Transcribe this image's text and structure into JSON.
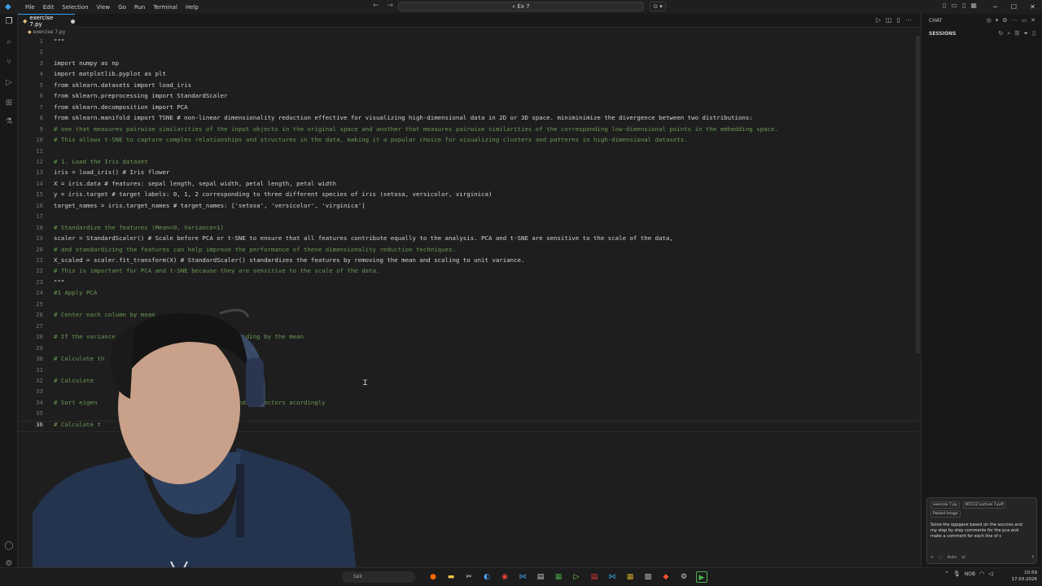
{
  "titlebar": {
    "menu": [
      "File",
      "Edit",
      "Selection",
      "View",
      "Go",
      "Run",
      "Terminal",
      "Help"
    ],
    "search_text": "Ex 7",
    "copilot_label": "⊙ ▾"
  },
  "tabs": [
    {
      "label": "exercise 7.py",
      "modified": true
    }
  ],
  "breadcrumb": "exercise 7.py",
  "editor": {
    "lines": [
      {
        "n": "1",
        "text": "\"\"\"",
        "style": "code"
      },
      {
        "n": "2",
        "text": "",
        "style": "code"
      },
      {
        "n": "3",
        "text": "import numpy as np",
        "style": "code"
      },
      {
        "n": "4",
        "text": "import matplotlib.pyplot as plt",
        "style": "code"
      },
      {
        "n": "5",
        "text": "from sklearn.datasets import load_iris",
        "style": "code"
      },
      {
        "n": "6",
        "text": "from sklearn.preprocessing import StandardScaler",
        "style": "code"
      },
      {
        "n": "7",
        "text": "from sklearn.decomposition import PCA",
        "style": "code"
      },
      {
        "n": "8",
        "text": "from sklearn.manifold import TSNE # non-linear dimensionality reduction effective for visualizing high-dimensional data in 2D or 3D space. miniminimize the divergence between two distributions:",
        "style": "code"
      },
      {
        "n": "9",
        "text": "# one that measures pairwise similarities of the input objects in the original space and another that measures pairwise similarities of the corresponding low-dimensional points in the embedding space.",
        "style": "code"
      },
      {
        "n": "10",
        "text": "# This allows t-SNE to capture complex relationships and structures in the data, making it a popular choice for visualizing clusters and patterns in high-dimensional datasets.",
        "style": "code"
      },
      {
        "n": "11",
        "text": "",
        "style": "code"
      },
      {
        "n": "12",
        "text": "# 1. Load the Iris dataset",
        "style": "code"
      },
      {
        "n": "13",
        "text": "iris = load_iris() # Iris flower",
        "style": "code"
      },
      {
        "n": "14",
        "text": "X = iris.data # features: sepal length, sepal width, petal length, petal width",
        "style": "code"
      },
      {
        "n": "15",
        "text": "y = iris.target # target labels: 0, 1, 2 corresponding to three different species of iris (setosa, versicolor, virginica)",
        "style": "code"
      },
      {
        "n": "16",
        "text": "target_names = iris.target_names # target_names: ['setosa', 'versicolor', 'virginica']",
        "style": "code"
      },
      {
        "n": "17",
        "text": "",
        "style": "code"
      },
      {
        "n": "18",
        "text": "# Standardize the features (Mean=0, Variance=1)",
        "style": "code"
      },
      {
        "n": "19",
        "text": "scaler = StandardScaler() # Scale before PCA or t-SNE to ensure that all features contribute equally to the analysis. PCA and t-SNE are sensitive to the scale of the data,",
        "style": "code"
      },
      {
        "n": "20",
        "text": "# and standardizing the features can help improve the performance of these dimensionality reduction techniques.",
        "style": "code"
      },
      {
        "n": "21",
        "text": "X_scaled = scaler.fit_transform(X) # StandardScaler() standardizes the features by removing the mean and scaling to unit variance.",
        "style": "code"
      },
      {
        "n": "22",
        "text": "# This is important for PCA and t-SNE because they are sensitive to the scale of the data.",
        "style": "code"
      },
      {
        "n": "23",
        "text": "\"\"\"",
        "style": "code"
      },
      {
        "n": "24",
        "text": "#1 Apply PCA",
        "style": "comment"
      },
      {
        "n": "25",
        "text": "",
        "style": "comment"
      },
      {
        "n": "26",
        "text": "# Center each column by mean",
        "style": "comment"
      },
      {
        "n": "27",
        "text": "",
        "style": "comment"
      },
      {
        "n": "28",
        "text": "# If the variance                   ch column by dividing by the mean",
        "style": "comment"
      },
      {
        "n": "29",
        "text": "",
        "style": "comment"
      },
      {
        "n": "30",
        "text": "# Calculate th",
        "style": "comment"
      },
      {
        "n": "31",
        "text": "",
        "style": "comment"
      },
      {
        "n": "32",
        "text": "# Calculate",
        "style": "comment"
      },
      {
        "n": "33",
        "text": "",
        "style": "comment"
      },
      {
        "n": "34",
        "text": "# Sort eigen                         t the corresponding vectors acordingly",
        "style": "comment"
      },
      {
        "n": "35",
        "text": "",
        "style": "comment"
      },
      {
        "n": "36",
        "text": "# Calculate t",
        "style": "comment"
      }
    ]
  },
  "panel": {
    "header": "CHAT",
    "sessions": "SESSIONS",
    "chat_chips": [
      "exercise 7.py",
      "IKT112 Lecture 7.pdf"
    ],
    "chat_chip2": "Pasted Image",
    "chat_text": "Solve the oppgave based on the sources and my step by step comments for the pca and make a comment for each line of c",
    "chat_mode": "Auto"
  },
  "taskbar": {
    "search_text": "Søk",
    "lang": "NOB",
    "time": "10:59",
    "date": "17.03.2026"
  },
  "colors": {
    "accent": "#3a9ee8",
    "editor_bg": "#1e1e1e",
    "comment": "#6a9955"
  }
}
